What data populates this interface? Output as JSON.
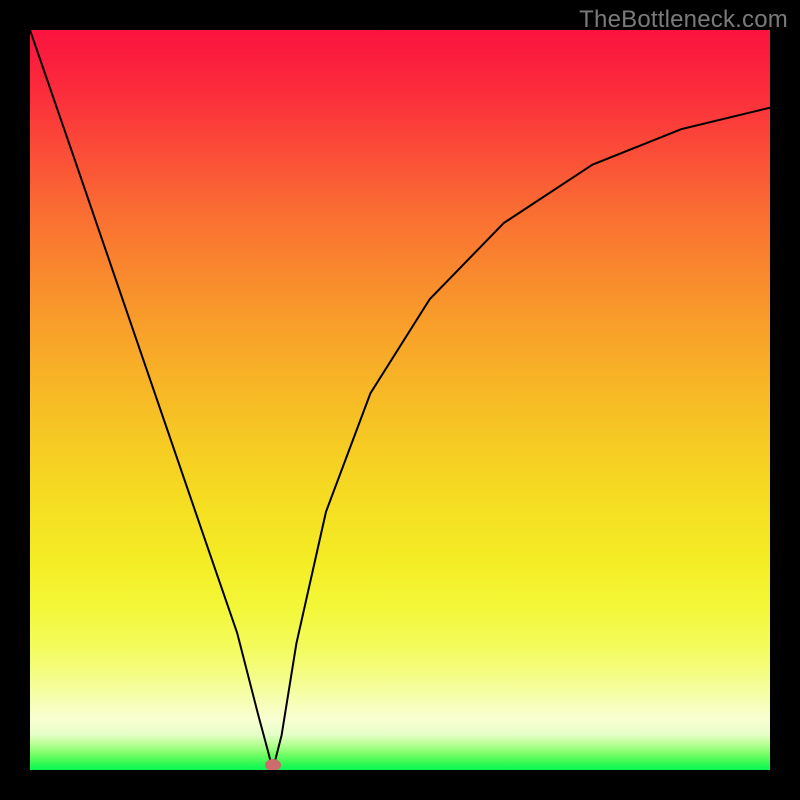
{
  "watermark": "TheBottleneck.com",
  "chart_data": {
    "type": "line",
    "title": "",
    "xlabel": "",
    "ylabel": "",
    "xlim": [
      0,
      1
    ],
    "ylim": [
      0,
      1
    ],
    "series": [
      {
        "name": "bottleneck-curve",
        "x": [
          0.0,
          0.06,
          0.12,
          0.18,
          0.24,
          0.28,
          0.308,
          0.322,
          0.328,
          0.34,
          0.36,
          0.4,
          0.46,
          0.54,
          0.64,
          0.76,
          0.88,
          1.0
        ],
        "y": [
          1.0,
          0.826,
          0.651,
          0.476,
          0.301,
          0.185,
          0.076,
          0.024,
          0.0,
          0.047,
          0.171,
          0.349,
          0.509,
          0.636,
          0.739,
          0.818,
          0.866,
          0.895
        ]
      }
    ],
    "annotations": [
      {
        "name": "marker-dot",
        "x": 0.328,
        "y": 0.0
      }
    ],
    "gradient_stops": [
      {
        "pos": 0.0,
        "color": "#fb133e"
      },
      {
        "pos": 0.5,
        "color": "#f7b626"
      },
      {
        "pos": 0.82,
        "color": "#f3f94a"
      },
      {
        "pos": 0.95,
        "color": "#e6ffc8"
      },
      {
        "pos": 1.0,
        "color": "#0af655"
      }
    ]
  }
}
